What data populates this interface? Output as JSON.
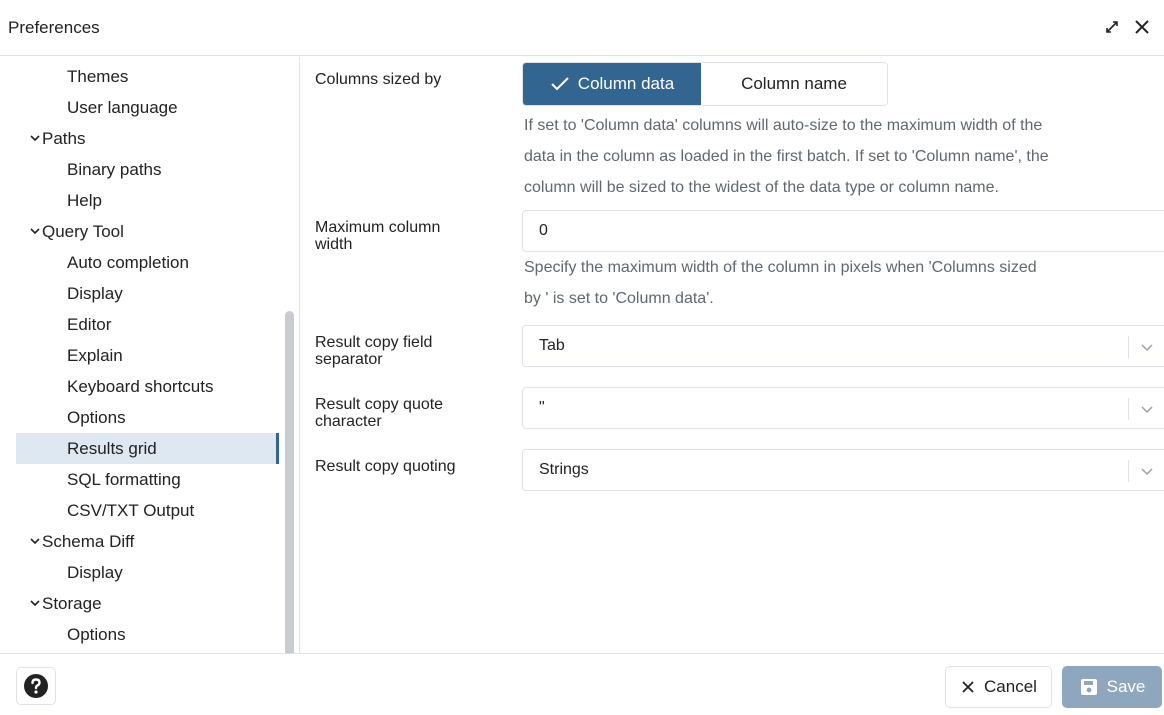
{
  "window": {
    "title": "Preferences"
  },
  "sidebar": {
    "items": [
      {
        "label": "Themes",
        "level": "child"
      },
      {
        "label": "User language",
        "level": "child"
      },
      {
        "label": "Paths",
        "level": "parent"
      },
      {
        "label": "Binary paths",
        "level": "child"
      },
      {
        "label": "Help",
        "level": "child"
      },
      {
        "label": "Query Tool",
        "level": "parent"
      },
      {
        "label": "Auto completion",
        "level": "child"
      },
      {
        "label": "Display",
        "level": "child"
      },
      {
        "label": "Editor",
        "level": "child"
      },
      {
        "label": "Explain",
        "level": "child"
      },
      {
        "label": "Keyboard shortcuts",
        "level": "child"
      },
      {
        "label": "Options",
        "level": "child"
      },
      {
        "label": "Results grid",
        "level": "child",
        "selected": true
      },
      {
        "label": "SQL formatting",
        "level": "child"
      },
      {
        "label": "CSV/TXT Output",
        "level": "child"
      },
      {
        "label": "Schema Diff",
        "level": "parent"
      },
      {
        "label": "Display",
        "level": "child"
      },
      {
        "label": "Storage",
        "level": "parent"
      },
      {
        "label": "Options",
        "level": "child"
      }
    ]
  },
  "form": {
    "columns_sized_by": {
      "label": "Columns sized by",
      "options": [
        "Column data",
        "Column name"
      ],
      "selected": "Column data",
      "help_lines": [
        "If set to 'Column data' columns will auto-size to the maximum width of the",
        "data in the column as loaded in the first batch. If set to 'Column name', the",
        "column will be sized to the widest of the data type or column name."
      ]
    },
    "max_column_width": {
      "label_line1": "Maximum column",
      "label_line2": "width",
      "value": "0",
      "help_lines": [
        "Specify the maximum width of the column in pixels when 'Columns sized",
        "by ' is set to 'Column data'."
      ]
    },
    "copy_field_separator": {
      "label_line1": "Result copy field",
      "label_line2": "separator",
      "value": "Tab"
    },
    "copy_quote_character": {
      "label_line1": "Result copy quote",
      "label_line2": "character",
      "value": "\""
    },
    "copy_quoting": {
      "label": "Result copy quoting",
      "value": "Strings"
    }
  },
  "footer": {
    "cancel_label": "Cancel",
    "save_label": "Save"
  },
  "colors": {
    "accent": "#326690",
    "selected_bg": "#dde8f3",
    "save_disabled": "#8fa7be",
    "help_text": "#60676f",
    "border": "#dfe3e8"
  },
  "icons": [
    "expand-icon",
    "close-icon",
    "chevron-down-icon",
    "check-icon",
    "help-icon",
    "cancel-x-icon",
    "save-icon"
  ]
}
